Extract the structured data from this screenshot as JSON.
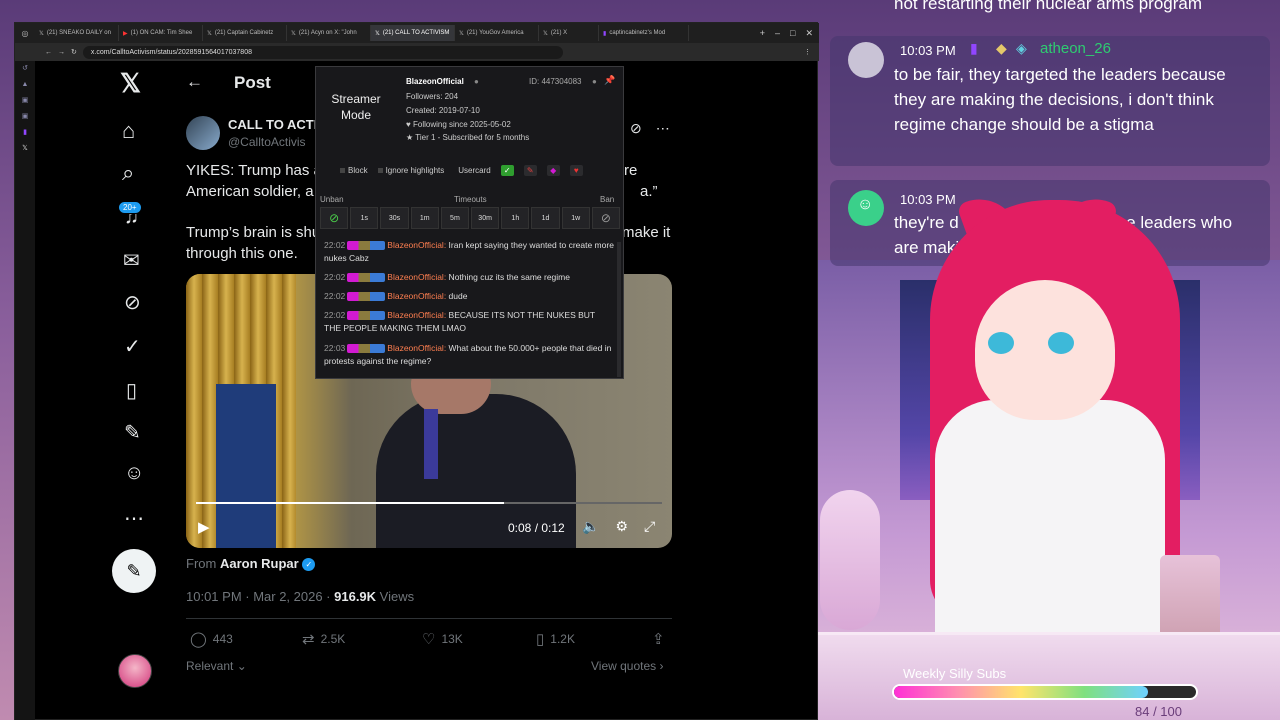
{
  "browser": {
    "tabs": [
      {
        "label": "(21) SNEAKO DAILY on"
      },
      {
        "label": "(1) ON CAM: Tim Shee"
      },
      {
        "label": "(21) Captain Cabinetz"
      },
      {
        "label": "(21) Acyn on X: \"John"
      },
      {
        "label": "(21) CALL TO ACTIVISM"
      },
      {
        "label": "(21) YouGov America"
      },
      {
        "label": "(21) X"
      },
      {
        "label": "captincabinetz's Mod"
      }
    ],
    "url": "x.com/CalltoActivism/status/2028591564017037808"
  },
  "x": {
    "badge": "20+",
    "post_header": "Post",
    "author_name": "CALL TO ACTI",
    "author_handle": "@CalltoActivis",
    "text_line1_left": "YIKES: Trump has a",
    "text_line1_right": "re",
    "text_line2_left": "American soldier, a",
    "text_line2_right": "a.”",
    "text_line3_left": "Trump’s brain is shu",
    "text_line3_right": "make it",
    "text_line4": "through this one.",
    "video_time": "0:08 / 0:12",
    "video_progress": 0.66,
    "from_label": "From",
    "from_author": "Aaron Rupar",
    "meta_date": "10:01 PM · Mar 2, 2026 · ",
    "meta_views_count": "916.9K",
    "meta_views_label": " Views",
    "replies": "443",
    "reposts": "2.5K",
    "likes": "13K",
    "bookmarks": "1.2K",
    "relevant": "Relevant",
    "view_quotes": "View quotes"
  },
  "usercard": {
    "streamer_mode": "Streamer Mode",
    "username": "BlazeonOfficial",
    "id": "ID: 447304083",
    "followers": "Followers: 204",
    "created": "Created: 2019-07-10",
    "following": "Following since 2025-05-02",
    "tier": "Tier 1 - Subscribed for 5 months",
    "block": "Block",
    "ignore": "Ignore highlights",
    "usercard_label": "Usercard",
    "unban": "Unban",
    "timeouts": "Timeouts",
    "ban": "Ban",
    "timeout_options": [
      "1s",
      "30s",
      "1m",
      "5m",
      "30m",
      "1h",
      "1d",
      "1w"
    ],
    "messages": [
      {
        "time": "22:02",
        "user": "BlazeonOfficial:",
        "text": " Iran kept saying they wanted to create more nukes Cabz"
      },
      {
        "time": "22:02",
        "user": "BlazeonOfficial:",
        "text": " Nothing cuz its the same regime"
      },
      {
        "time": "22:02",
        "user": "BlazeonOfficial:",
        "text": " dude"
      },
      {
        "time": "22:02",
        "user": "BlazeonOfficial:",
        "text": " BECAUSE ITS NOT THE NUKES BUT THE PEOPLE MAKING THEM LMAO"
      },
      {
        "time": "22:03",
        "user": "BlazeonOfficial:",
        "text": " What about the 50.000+ people that died in protests against the regime?"
      }
    ]
  },
  "chat": {
    "top_text": "not restarting their nuclear arms program",
    "msg1_time": "10:03 PM",
    "msg1_user": "atheon_26",
    "msg1_text": "to be fair, they targeted the leaders because they are making the decisions, i don't think regime change should be a stigma",
    "msg2_time": "10:03 PM",
    "msg2_text_a": "they're d",
    "msg2_text_b": "the leaders who",
    "msg2_text_c": "are maki"
  },
  "overlay": {
    "goal_label": "Weekly Silly Subs",
    "goal_count": "84 / 100",
    "goal_progress": 0.84
  },
  "colors": {
    "x_blue": "#1d9bf0",
    "username_orange": "#ff7f50",
    "chat_green": "#2ecc71"
  }
}
